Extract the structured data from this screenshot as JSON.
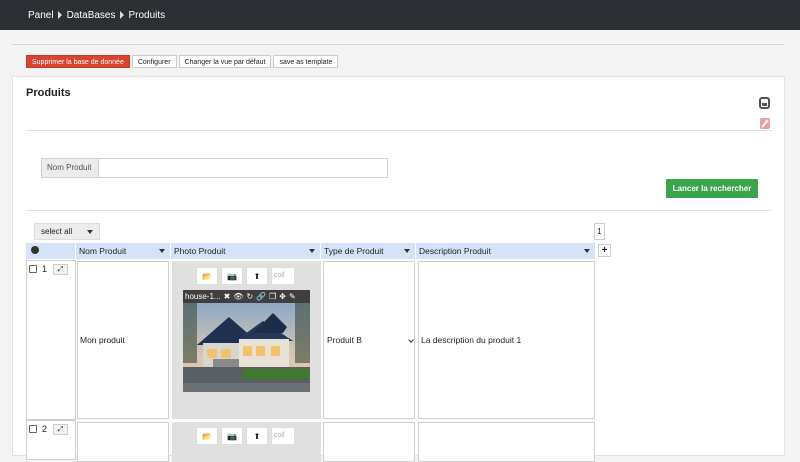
{
  "breadcrumb": [
    "Panel",
    "DataBases",
    "Produits"
  ],
  "actions": {
    "delete_db": "Supprimer la base de donnée",
    "configure": "Configurer",
    "change_view": "Changer la vue par défaut",
    "save_template": "save as template"
  },
  "page_title": "Produits",
  "search": {
    "label": "Nom Produit",
    "value": ""
  },
  "launch_search": "Lancer la rechercher",
  "select_all": "select all",
  "page": "1",
  "columns": [
    "Nom Produit",
    "Photo Produit",
    "Type de Produit",
    "Description Produit"
  ],
  "add_column": "+",
  "rows": [
    {
      "num": "1",
      "name": "Mon produit",
      "photo_filename": "house-1...",
      "photo_input_placeholder": "coll",
      "type": "Produit B",
      "description": "La description du produit 1"
    },
    {
      "num": "2",
      "name": "",
      "photo_filename": "",
      "photo_input_placeholder": "coll",
      "type": "",
      "description": ""
    }
  ],
  "icons": {
    "expand": "⤢",
    "folder": "📂",
    "camera": "📷",
    "upload": "⬆",
    "delete": "✖",
    "view": "👁",
    "rotate": "↻",
    "link": "🔗",
    "copy": "❐",
    "move": "✥",
    "edit": "✎"
  },
  "colors": {
    "topbar": "#2c2f33",
    "danger": "#d9432f",
    "success": "#3aa54b",
    "table_header": "#d6e2f8"
  }
}
